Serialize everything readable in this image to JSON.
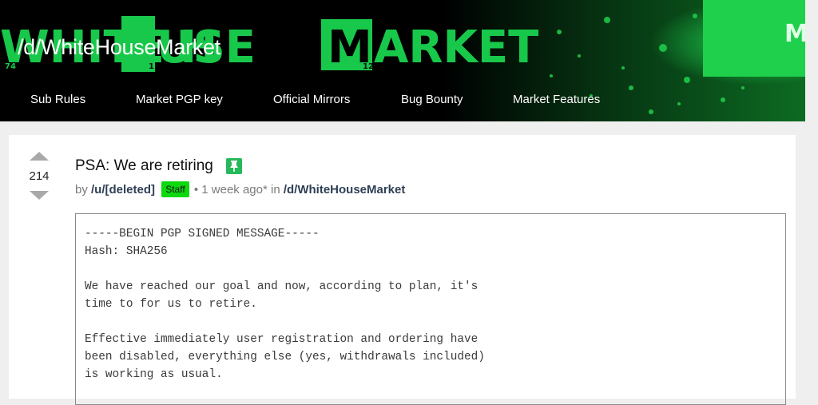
{
  "header": {
    "forum_title": "/d/WhiteHouseMarket",
    "logo_text_a": "WHITE H",
    "logo_text_b": "USE",
    "logo_text_c": "ARKET",
    "logo_tile_o": "O",
    "logo_tile_m": "M",
    "logo_num_74": "74",
    "logo_num_1": "1",
    "logo_num_12": "12",
    "logo_edge_letter": "M",
    "nav": [
      {
        "label": "Sub Rules"
      },
      {
        "label": "Market PGP key"
      },
      {
        "label": "Official Mirrors"
      },
      {
        "label": "Bug Bounty"
      },
      {
        "label": "Market Features"
      }
    ],
    "colors": {
      "accent_green": "#18c84a",
      "banner_bg": "#000000"
    }
  },
  "post": {
    "votes": "214",
    "title": "PSA: We are retiring",
    "pin_icon": "pin-icon",
    "by_label": "by",
    "author": "/u/[deleted]",
    "staff_label": "Staff",
    "time": "• 1 week ago* in",
    "community": "/d/WhiteHouseMarket",
    "body_lines": [
      "-----BEGIN PGP SIGNED MESSAGE-----",
      "Hash: SHA256",
      "",
      "We have reached our goal and now, according to plan, it's",
      "time to for us to retire.",
      "",
      "Effective immediately user registration and ordering have",
      "been disabled, everything else (yes, withdrawals included)",
      "is working as usual."
    ]
  }
}
